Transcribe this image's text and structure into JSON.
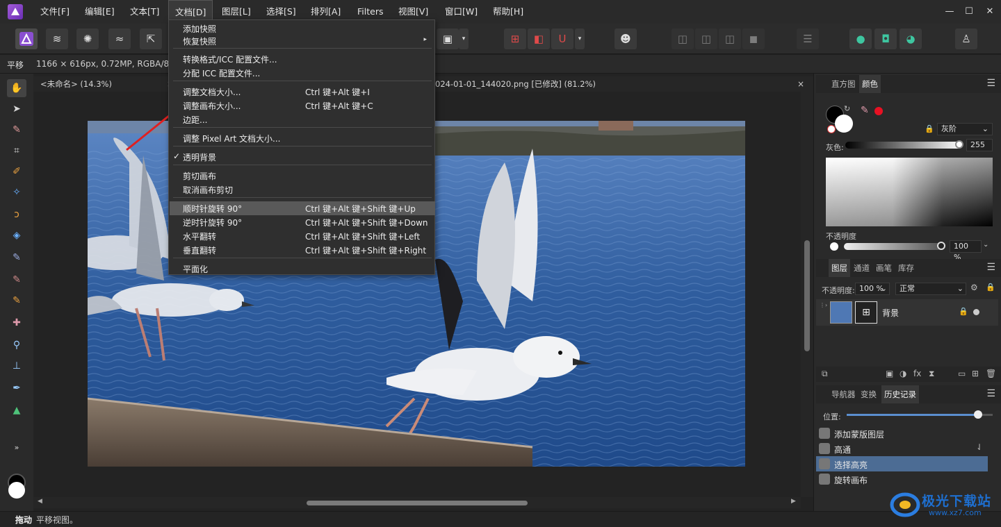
{
  "menubar": {
    "items": [
      "文件[F]",
      "编辑[E]",
      "文本[T]",
      "文档[D]",
      "图层[L]",
      "选择[S]",
      "排列[A]",
      "Filters",
      "视图[V]",
      "窗口[W]",
      "帮助[H]"
    ],
    "window_controls": {
      "minimize": "—",
      "maximize": "☐",
      "close": "✕"
    }
  },
  "context": {
    "tool": "平移",
    "info": "1166 × 616px, 0.72MP, RGBA/8 -"
  },
  "doc_tabs": {
    "tab1": "<未命名> (14.3%)",
    "tab1_close": "×",
    "tab2": "024-01-01_144020.png [已修改] (81.2%)",
    "tab2_close": "×"
  },
  "doc_menu": {
    "items": [
      {
        "label": "添加快照",
        "shortcut": ""
      },
      {
        "label": "恢复快照",
        "shortcut": "",
        "submenu_arrow": "▸"
      },
      {
        "label": "转换格式/ICC 配置文件...",
        "shortcut": ""
      },
      {
        "label": "分配 ICC 配置文件...",
        "shortcut": ""
      },
      {
        "label": "调整文档大小...",
        "shortcut": "Ctrl 键+Alt 键+I"
      },
      {
        "label": "调整画布大小...",
        "shortcut": "Ctrl 键+Alt 键+C"
      },
      {
        "label": "边距...",
        "shortcut": ""
      },
      {
        "label": "调整 Pixel Art 文档大小...",
        "shortcut": ""
      },
      {
        "label": "透明背景",
        "shortcut": "",
        "check": "✓"
      },
      {
        "label": "剪切画布",
        "shortcut": ""
      },
      {
        "label": "取消画布剪切",
        "shortcut": ""
      },
      {
        "label": "顺时针旋转 90°",
        "shortcut": "Ctrl 键+Alt 键+Shift 键+Up"
      },
      {
        "label": "逆时针旋转 90°",
        "shortcut": "Ctrl 键+Alt 键+Shift 键+Down"
      },
      {
        "label": "水平翻转",
        "shortcut": "Ctrl 键+Alt 键+Shift 键+Left"
      },
      {
        "label": "垂直翻转",
        "shortcut": "Ctrl 键+Alt 键+Shift 键+Right"
      },
      {
        "label": "平面化",
        "shortcut": ""
      }
    ],
    "highlighted_index": 11
  },
  "color_panel": {
    "tabs": [
      "直方图",
      "颜色"
    ],
    "active_tab": "颜色",
    "mode": "灰阶",
    "gray_label": "灰色:",
    "gray_value": "255",
    "opacity_label": "不透明度",
    "opacity_value": "100 %",
    "accent": "#e81123"
  },
  "layers_panel": {
    "tabs": [
      "图层",
      "通道",
      "画笔",
      "库存"
    ],
    "active_tab": "图层",
    "opacity_label": "不透明度:",
    "opacity_value": "100 %",
    "blend_mode": "正常",
    "layers": [
      {
        "name": "背景"
      }
    ]
  },
  "history_panel": {
    "tabs": [
      "导航器",
      "变换",
      "历史记录"
    ],
    "active_tab": "历史记录",
    "position_label": "位置:",
    "position_fraction": 0.9,
    "items": [
      "添加蒙版图层",
      "高通",
      "选择高亮",
      "旋转画布"
    ],
    "selected_index": 2
  },
  "statusbar": {
    "action": "拖动",
    "message": "平移视图。"
  },
  "watermark": {
    "brand": "极光下载站",
    "url": "www.xz7.com"
  }
}
